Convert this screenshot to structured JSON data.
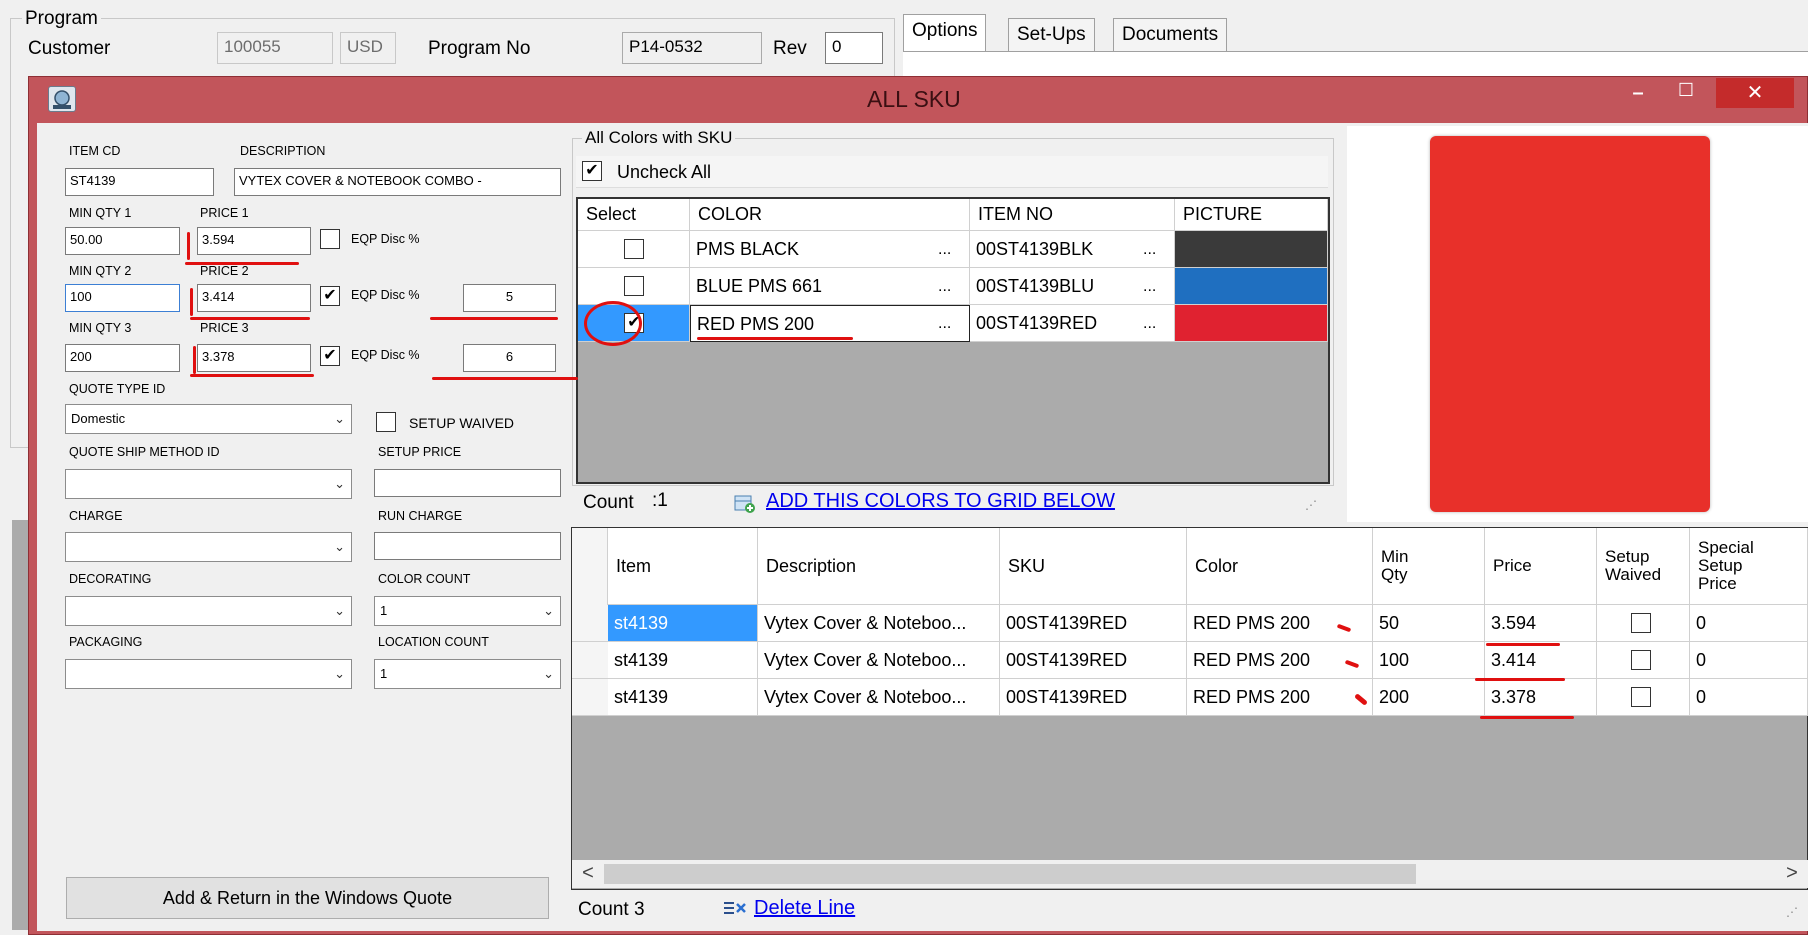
{
  "background": {
    "group_title": "Program",
    "customer_label": "Customer",
    "customer_value": "100055",
    "currency": "USD",
    "program_no_label": "Program No",
    "program_no_value": "P14-0532",
    "rev_label": "Rev",
    "rev_value": "0",
    "tabs": [
      {
        "label": "Options"
      },
      {
        "label": "Set-Ups"
      },
      {
        "label": "Documents"
      }
    ]
  },
  "dialog": {
    "title": "ALL SKU",
    "controls": {
      "minimize": "–",
      "maximize": "☐",
      "close": "✕"
    }
  },
  "form": {
    "item_cd_label": "ITEM CD",
    "description_label": "DESCRIPTION",
    "item_cd_value": "ST4139",
    "description_value": "VYTEX COVER & NOTEBOOK COMBO -",
    "tiers": [
      {
        "qty_label": "MIN QTY 1",
        "price_label": "PRICE 1",
        "qty": "50.00",
        "price": "3.594",
        "eqp_checked": false,
        "eqp_label": "EQP Disc %",
        "disc": ""
      },
      {
        "qty_label": "MIN QTY 2",
        "price_label": "PRICE 2",
        "qty": "100",
        "price": "3.414",
        "eqp_checked": true,
        "eqp_label": "EQP Disc %",
        "disc": "5"
      },
      {
        "qty_label": "MIN QTY 3",
        "price_label": "PRICE 3",
        "qty": "200",
        "price": "3.378",
        "eqp_checked": true,
        "eqp_label": "EQP Disc %",
        "disc": "6"
      }
    ],
    "quote_type_label": "QUOTE TYPE ID",
    "quote_type_value": "Domestic",
    "setup_waived_label": "SETUP WAIVED",
    "ship_method_label": "QUOTE SHIP METHOD ID",
    "setup_price_label": "SETUP PRICE",
    "charge_label": "CHARGE",
    "run_charge_label": "RUN CHARGE",
    "decorating_label": "DECORATING",
    "color_count_label": "COLOR COUNT",
    "color_count_value": "1",
    "packaging_label": "PACKAGING",
    "location_count_label": "LOCATION COUNT",
    "location_count_value": "1",
    "add_return_button": "Add & Return in the Windows Quote"
  },
  "colors": {
    "group_title": "All Colors  with SKU",
    "uncheck_all_label": "Uncheck All",
    "headers": [
      "Select",
      "COLOR",
      "ITEM NO",
      "PICTURE"
    ],
    "rows": [
      {
        "checked": false,
        "color": "PMS BLACK",
        "item_no": "00ST4139BLK",
        "swatch": "#3a3a3a"
      },
      {
        "checked": false,
        "color": "BLUE PMS 661",
        "item_no": "00ST4139BLU",
        "swatch": "#1f6fc0"
      },
      {
        "checked": true,
        "color": "RED PMS 200",
        "item_no": "00ST4139RED",
        "swatch": "#e02230"
      }
    ],
    "ellipsis": "...",
    "count_label": "Count",
    "count_value": ":1",
    "add_colors_link": "ADD THIS COLORS TO GRID BELOW"
  },
  "preview": {
    "product_color": "#e8302a"
  },
  "grid": {
    "headers": [
      "Item",
      "Description",
      "SKU",
      "Color",
      "Min Qty",
      "Price",
      "Setup Waived",
      "Special Setup Price"
    ],
    "rows": [
      {
        "item": "st4139",
        "description": "Vytex Cover & Noteboo...",
        "sku": "00ST4139RED",
        "color": "RED PMS 200",
        "min_qty": "50",
        "price": "3.594",
        "setup_waived": false,
        "special_setup_price": "0"
      },
      {
        "item": "st4139",
        "description": "Vytex Cover & Noteboo...",
        "sku": "00ST4139RED",
        "color": "RED PMS 200",
        "min_qty": "100",
        "price": "3.414",
        "setup_waived": false,
        "special_setup_price": "0"
      },
      {
        "item": "st4139",
        "description": "Vytex Cover & Noteboo...",
        "sku": "00ST4139RED",
        "color": "RED PMS 200",
        "min_qty": "200",
        "price": "3.378",
        "setup_waived": false,
        "special_setup_price": "0"
      }
    ],
    "count_label": "Count 3",
    "delete_link": "Delete Line",
    "scroll_left": "<",
    "scroll_right": ">"
  }
}
